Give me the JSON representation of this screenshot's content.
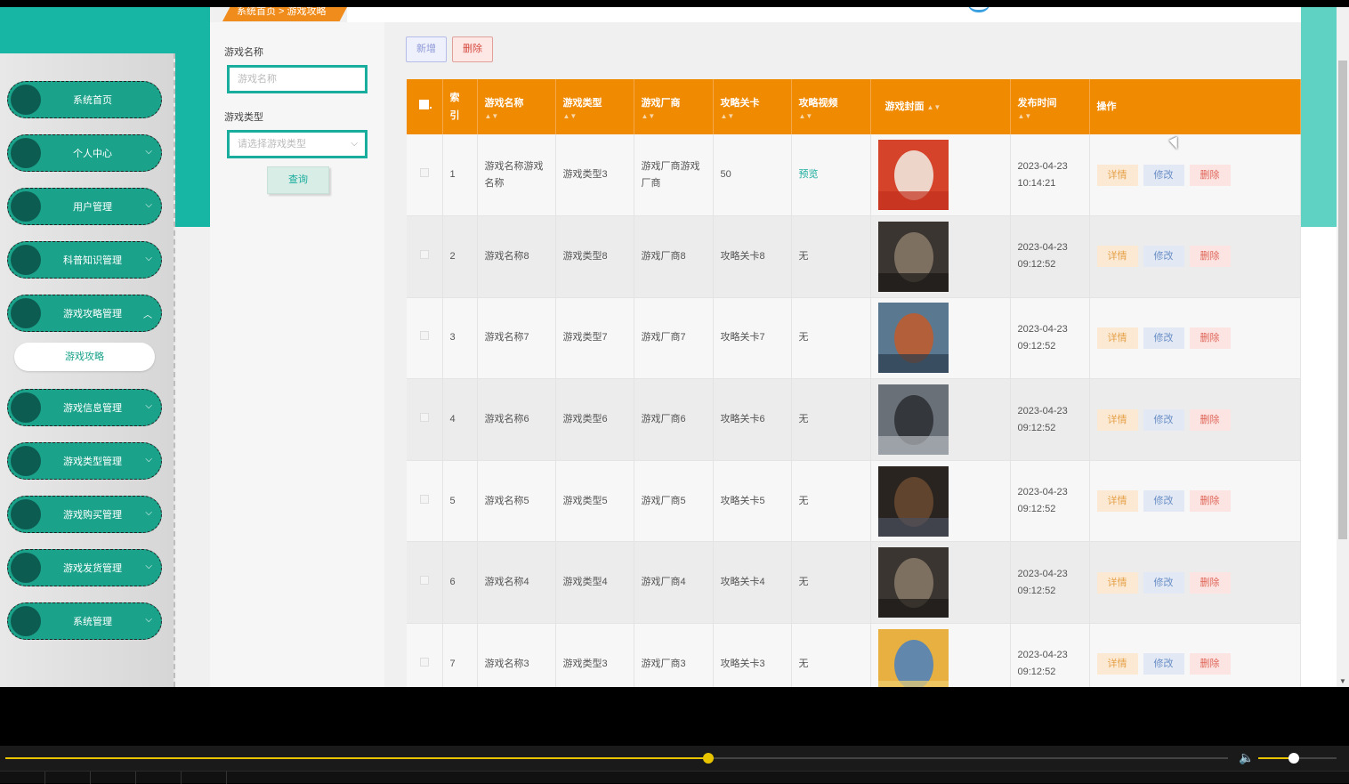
{
  "breadcrumb": {
    "text": "系统首页 > 游戏攻略"
  },
  "sidebar": {
    "items": [
      {
        "label": "系统首页",
        "has_chevron": false
      },
      {
        "label": "个人中心",
        "chevron": "⌵"
      },
      {
        "label": "用户管理",
        "chevron": "⌵"
      },
      {
        "label": "科普知识管理",
        "chevron": "⌵"
      },
      {
        "label": "游戏攻略管理",
        "chevron": "︿"
      },
      {
        "label": "游戏信息管理",
        "chevron": "⌵"
      },
      {
        "label": "游戏类型管理",
        "chevron": "⌵"
      },
      {
        "label": "游戏购买管理",
        "chevron": "⌵"
      },
      {
        "label": "游戏发货管理",
        "chevron": "⌵"
      },
      {
        "label": "系统管理",
        "chevron": "⌵"
      }
    ],
    "sub_item": {
      "label": "游戏攻略"
    }
  },
  "search": {
    "name_label": "游戏名称",
    "name_placeholder": "游戏名称",
    "type_label": "游戏类型",
    "type_placeholder": "请选择游戏类型",
    "query_label": "查询"
  },
  "toolbar": {
    "add_label": "新增",
    "delete_label": "删除"
  },
  "table": {
    "columns": {
      "index_line1": "索",
      "index_line2": "引",
      "name": "游戏名称",
      "type": "游戏类型",
      "vendor": "游戏厂商",
      "level": "攻略关卡",
      "video": "攻略视频",
      "cover": "游戏封面",
      "time": "发布时间",
      "actions": "操作"
    },
    "action_labels": {
      "detail": "详情",
      "edit": "修改",
      "delete": "删除"
    },
    "rows": [
      {
        "index": "1",
        "name": "游戏名称游戏名称",
        "type": "游戏类型3",
        "vendor": "游戏厂商游戏厂商",
        "level": "50",
        "video": "预览",
        "time": "2023-04-23 10:14:21",
        "cover_colors": [
          "#d4432a",
          "#f2efe6",
          "#c33020"
        ]
      },
      {
        "index": "2",
        "name": "游戏名称8",
        "type": "游戏类型8",
        "vendor": "游戏厂商8",
        "level": "攻略关卡8",
        "video": "无",
        "time": "2023-04-23 09:12:52",
        "cover_colors": [
          "#3a3530",
          "#8b7a6a",
          "#1a1816"
        ]
      },
      {
        "index": "3",
        "name": "游戏名称7",
        "type": "游戏类型7",
        "vendor": "游戏厂商7",
        "level": "攻略关卡7",
        "video": "无",
        "time": "2023-04-23 09:12:52",
        "cover_colors": [
          "#5a7890",
          "#c35a2a",
          "#2a3a4a"
        ]
      },
      {
        "index": "4",
        "name": "游戏名称6",
        "type": "游戏类型6",
        "vendor": "游戏厂商6",
        "level": "攻略关卡6",
        "video": "无",
        "time": "2023-04-23 09:12:52",
        "cover_colors": [
          "#6a7078",
          "#2a2e32",
          "#b4b8bc"
        ]
      },
      {
        "index": "5",
        "name": "游戏名称5",
        "type": "游戏类型5",
        "vendor": "游戏厂商5",
        "level": "攻略关卡5",
        "video": "无",
        "time": "2023-04-23 09:12:52",
        "cover_colors": [
          "#2a2420",
          "#6a4a30",
          "#4a5060"
        ]
      },
      {
        "index": "6",
        "name": "游戏名称4",
        "type": "游戏类型4",
        "vendor": "游戏厂商4",
        "level": "攻略关卡4",
        "video": "无",
        "time": "2023-04-23 09:12:52",
        "cover_colors": [
          "#3a3530",
          "#8b7a6a",
          "#1a1816"
        ]
      },
      {
        "index": "7",
        "name": "游戏名称3",
        "type": "游戏类型3",
        "vendor": "游戏厂商3",
        "level": "攻略关卡3",
        "video": "无",
        "time": "2023-04-23 09:12:52",
        "cover_colors": [
          "#e8b040",
          "#4a80c0",
          "#f0d070"
        ]
      }
    ]
  },
  "player": {
    "progress": 0.575,
    "volume": 0.45
  },
  "colors": {
    "accent_teal": "#17b5a3",
    "header_orange": "#f08a00",
    "sidebar_item": "#1aa38a"
  }
}
